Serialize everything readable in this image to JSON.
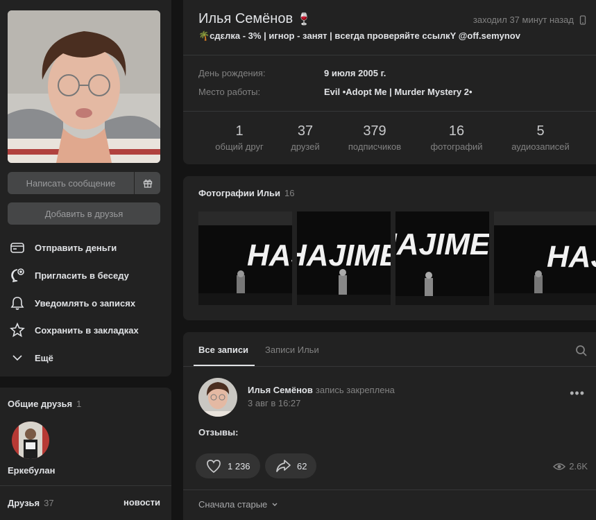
{
  "profile": {
    "name": "Илья Семёнов",
    "name_emoji": "🍷",
    "last_seen": "заходил 37 минут назад",
    "status": "🌴сдɛлкa - 3% | игнoр - зaнят | вceгдa прoвeряйтe ccылкY @off.semynov",
    "birthday_label": "День рождения:",
    "birthday_value": "9 июля 2005 г.",
    "work_label": "Место работы:",
    "work_value": "Evil •Adopt Me | Murder Mystery 2•"
  },
  "counters": [
    {
      "num": "1",
      "label": "общий друг"
    },
    {
      "num": "37",
      "label": "друзей"
    },
    {
      "num": "379",
      "label": "подписчиков"
    },
    {
      "num": "16",
      "label": "фотографий"
    },
    {
      "num": "5",
      "label": "аудиозаписей"
    }
  ],
  "actions": {
    "message": "Написать сообщение",
    "add_friend": "Добавить в друзья"
  },
  "menu": [
    {
      "label": "Отправить деньги",
      "icon": "wallet-icon"
    },
    {
      "label": "Пригласить в беседу",
      "icon": "chat-add-icon"
    },
    {
      "label": "Уведомлять о записях",
      "icon": "bell-icon"
    },
    {
      "label": "Сохранить в закладках",
      "icon": "star-icon"
    },
    {
      "label": "Ещё",
      "icon": "chevron-down-icon"
    }
  ],
  "common_friends": {
    "title": "Общие друзья",
    "count": "1",
    "friend_name": "Еркебулан"
  },
  "friends": {
    "title": "Друзья",
    "count": "37",
    "news_link": "новости"
  },
  "photos": {
    "title": "Фотографии Ильи",
    "count": "16",
    "text_in_photos": "HAJIME"
  },
  "wall": {
    "tab_all": "Все записи",
    "tab_own": "Записи Ильи",
    "post": {
      "author": "Илья Семёнов",
      "pinned": "запись закреплена",
      "date": "3 авг в 16:27",
      "text": "Отзывы:",
      "likes": "1 236",
      "shares": "62",
      "views": "2.6K"
    },
    "sort": "Сначала старые"
  },
  "colors": {
    "background": "#141414",
    "card": "#222222",
    "text": "#e1e3e6",
    "muted": "#828282",
    "button": "#454647"
  }
}
